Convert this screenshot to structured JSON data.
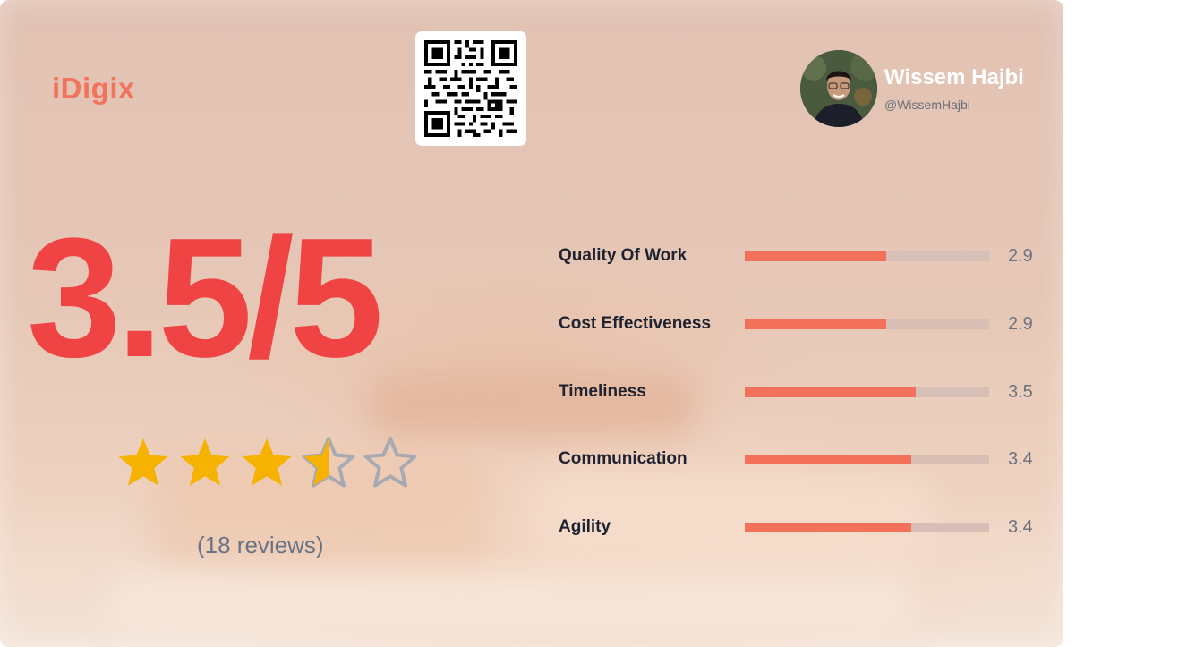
{
  "brand": {
    "name": "iDigix"
  },
  "profile": {
    "name": "Wissem Hajbi",
    "handle": "@WissemHajbi",
    "avatar_icon": "user-photo-avatar"
  },
  "qr": {
    "icon": "qr-code-icon"
  },
  "rating": {
    "score_text": "3.5/5",
    "value": 3.5,
    "max": 5,
    "reviews_text": "(18 reviews)",
    "star_filled_color": "#f6b200",
    "star_empty_color": "#a7aab3"
  },
  "metrics": [
    {
      "label": "Quality Of Work",
      "value": 2.9,
      "value_text": "2.9"
    },
    {
      "label": "Cost Effectiveness",
      "value": 2.9,
      "value_text": "2.9"
    },
    {
      "label": "Timeliness",
      "value": 3.5,
      "value_text": "3.5"
    },
    {
      "label": "Communication",
      "value": 3.4,
      "value_text": "3.4"
    },
    {
      "label": "Agility",
      "value": 3.4,
      "value_text": "3.4"
    }
  ],
  "colors": {
    "accent": "#f3705a",
    "score": "#ef4443",
    "track": "#d8bfb5"
  }
}
